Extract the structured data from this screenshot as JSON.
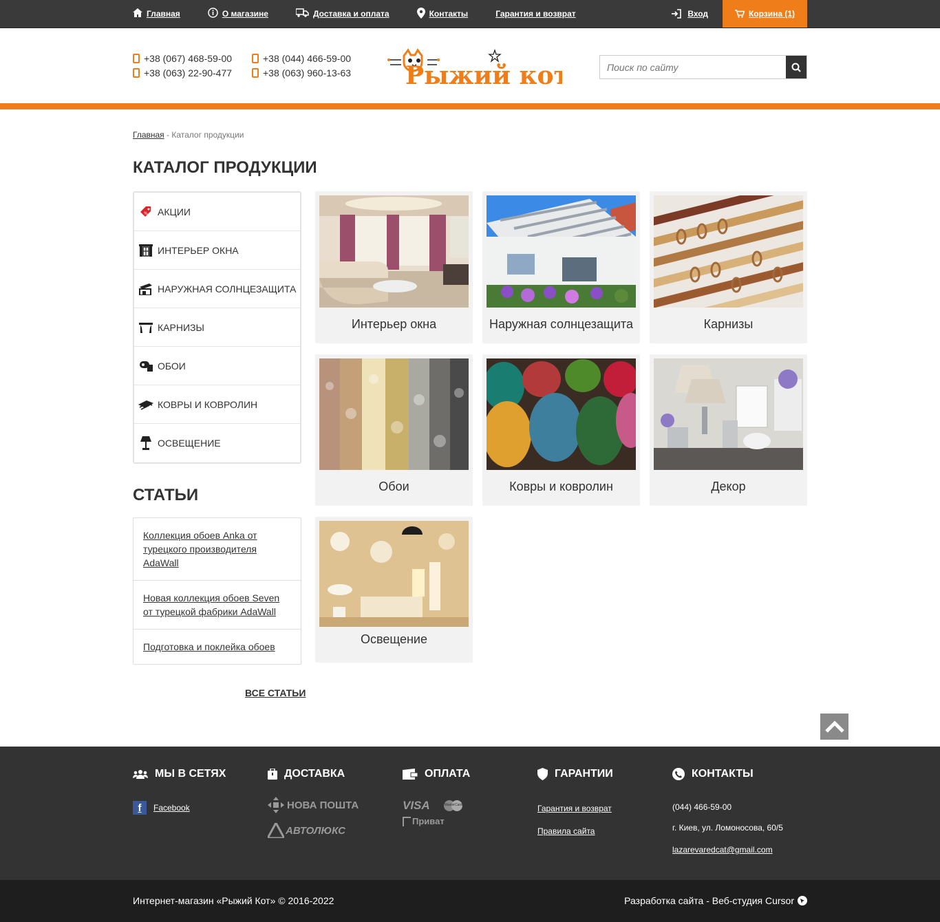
{
  "topnav": {
    "items": [
      {
        "label": "Главная",
        "icon": "home-icon"
      },
      {
        "label": "О магазине",
        "icon": "info-icon"
      },
      {
        "label": "Доставка и оплата",
        "icon": "truck-icon"
      },
      {
        "label": "Контакты",
        "icon": "map-pin-icon"
      },
      {
        "label": "Гарантия и возврат",
        "icon": ""
      }
    ],
    "login": "Вход",
    "cart": "Корзина (1)"
  },
  "header": {
    "phones": [
      "+38 (067) 468-59-00",
      "+38 (044) 466-59-00",
      "+38 (063) 22-90-477",
      "+38 (063) 960-13-63"
    ],
    "logo_text": "Рыжий кот",
    "search_placeholder": "Поиск по сайту"
  },
  "breadcrumb": {
    "home": "Главная",
    "separator": " - ",
    "current": "Каталог продукции"
  },
  "page_title": "КАТАЛОГ ПРОДУКЦИИ",
  "sidebar": {
    "items": [
      {
        "label": "АКЦИИ",
        "icon": "sale-tag-icon"
      },
      {
        "label": "ИНТЕРЬЕР ОКНА",
        "icon": "window-icon"
      },
      {
        "label": "НАРУЖНАЯ СОЛНЦЕЗАЩИТА",
        "icon": "awning-icon"
      },
      {
        "label": "КАРНИЗЫ",
        "icon": "curtain-rod-icon"
      },
      {
        "label": "ОБОИ",
        "icon": "wallpaper-roll-icon"
      },
      {
        "label": "КОВРЫ И КОВРОЛИН",
        "icon": "carpet-icon"
      },
      {
        "label": "ОСВЕЩЕНИЕ",
        "icon": "lamp-icon"
      }
    ]
  },
  "articles": {
    "title": "СТАТЬИ",
    "items": [
      "Коллекция обоев Anka от турецкого производителя AdaWall",
      "Новая коллекция обоев Seven от турецкой фабрики AdaWall",
      "Подготовка и поклейка обоев"
    ],
    "all_link": "ВСЕ СТАТЬИ"
  },
  "catalog": [
    {
      "label": "Интерьер окна",
      "image": "living-room-image"
    },
    {
      "label": "Наружная солнцезащита",
      "image": "awning-image"
    },
    {
      "label": "Карнизы",
      "image": "curtain-rods-image"
    },
    {
      "label": "Обои",
      "image": "wallpaper-rolls-image"
    },
    {
      "label": "Ковры и ковролин",
      "image": "carpet-rolls-image"
    },
    {
      "label": "Декор",
      "image": "decor-image"
    },
    {
      "label": "Освещение",
      "image": "lighting-image"
    }
  ],
  "footer": {
    "social": {
      "title": "МЫ В СЕТЯХ",
      "facebook": "Facebook"
    },
    "delivery": {
      "title": "ДОСТАВКА",
      "carriers": [
        "НОВА ПОШТА",
        "АВТОЛЮКС"
      ]
    },
    "payment": {
      "title": "ОПЛАТА",
      "methods": [
        "VISA",
        "MasterCard",
        "Приват"
      ]
    },
    "guarantee": {
      "title": "ГАРАНТИИ",
      "links": [
        "Гарантия и возврат",
        "Правила сайта"
      ]
    },
    "contacts": {
      "title": "КОНТАКТЫ",
      "phone": "(044) 466-59-00",
      "address": "г. Киев, ул. Ломоносова, 60/5",
      "email": "lazarevaredcat@gmail.com"
    }
  },
  "bottom": {
    "copyright": "Интернет-магазин «Рыжий Кот» © 2016-2022",
    "developer": "Разработка сайта - Веб-студия Cursor"
  },
  "colors": {
    "accent": "#ef7d1a",
    "topbar": "#3a3a3a",
    "footer": "#333333"
  }
}
